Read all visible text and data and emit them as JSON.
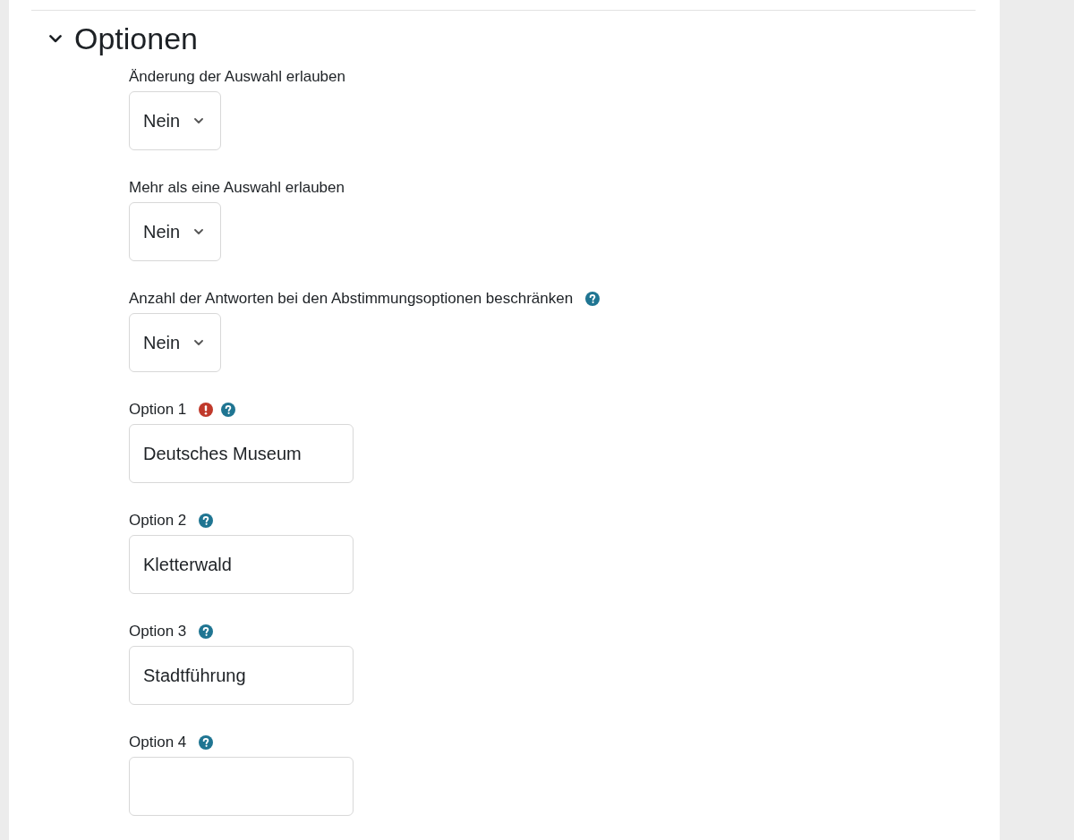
{
  "section": {
    "title": "Optionen",
    "expanded": true
  },
  "fields": [
    {
      "kind": "select",
      "label": "Änderung der Auswahl erlauben",
      "value": "Nein",
      "required": false,
      "help": false
    },
    {
      "kind": "select",
      "label": "Mehr als eine Auswahl erlauben",
      "value": "Nein",
      "required": false,
      "help": false
    },
    {
      "kind": "select",
      "label": "Anzahl der Antworten bei den Abstimmungsoptionen beschränken",
      "value": "Nein",
      "required": false,
      "help": true
    },
    {
      "kind": "text",
      "label": "Option 1",
      "value": "Deutsches Museum",
      "required": true,
      "help": true
    },
    {
      "kind": "text",
      "label": "Option 2",
      "value": "Kletterwald",
      "required": false,
      "help": true
    },
    {
      "kind": "text",
      "label": "Option 3",
      "value": "Stadtführung",
      "required": false,
      "help": true
    },
    {
      "kind": "text",
      "label": "Option 4",
      "required": false,
      "help": true
    }
  ]
}
